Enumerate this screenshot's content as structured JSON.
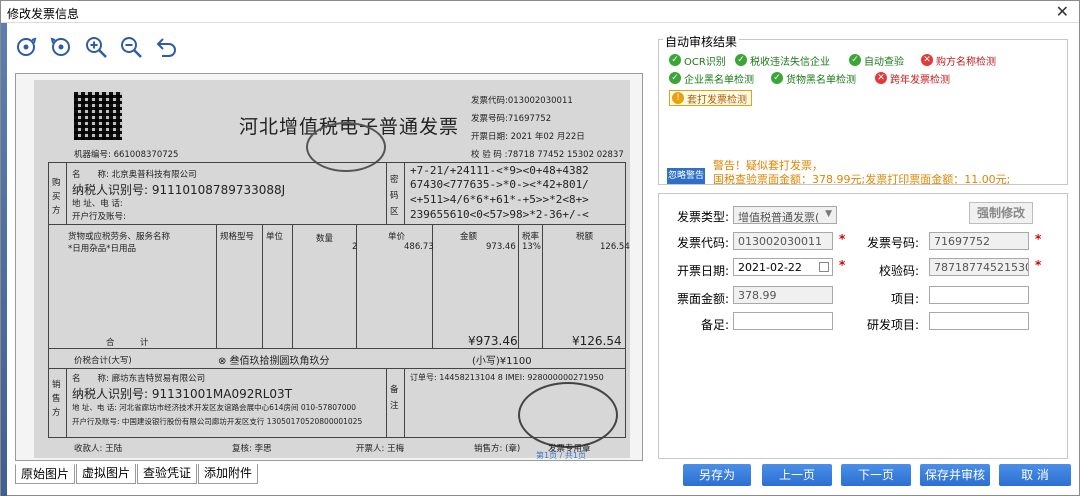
{
  "window": {
    "title": "修改发票信息",
    "close_glyph": "✕"
  },
  "toolbar": [
    {
      "name": "rotate-right-icon"
    },
    {
      "name": "rotate-left-icon"
    },
    {
      "name": "zoom-in-icon"
    },
    {
      "name": "zoom-out-icon"
    },
    {
      "name": "undo-icon"
    }
  ],
  "invoice_image": {
    "title": "河北增值税电子普通发票",
    "machine_no": "机器编号: 661008370725",
    "code": "发票代码:013002030011",
    "number": "发票号码:71697752",
    "date": "开票日期: 2021 年02 月22日",
    "check": "校 验 码 :78718 77452 15302 02837",
    "buyer_name": "名　　称: 北京奥普科技有限公司",
    "buyer_tax": "纳税人识别号: 91110108789733088J",
    "buyer_addr": "地 址、电 话:",
    "buyer_bank": "开户行及账号:",
    "cipher": [
      "+7-21/+24111-<*9><0+48+4382",
      "67430<777635->*0-><*42+801/",
      "<+511>4/6*6*+61*-+5>>*2<8+>",
      "239655610<0<57>98>*2-36+/-<"
    ],
    "item_header": [
      "货物或应税劳务、服务名称",
      "规格型号",
      "单位",
      "数量",
      "单价",
      "金额",
      "税率",
      "税额"
    ],
    "item_row": [
      "*日用杂品*日用品",
      "2",
      "486.73",
      "973.46",
      "13%",
      "126.54"
    ],
    "total_label": "合　　　计",
    "total_amount": "¥973.46",
    "total_tax": "¥126.54",
    "grand_label": "价税合计(大写)",
    "grand_words": "⊗ 叁佰玖拾捌圆玖角玖分",
    "grand_small": "(小写)¥1100",
    "seller_name": "名　　称: 廊坊东吉特贸易有限公司",
    "seller_tax": "纳税人识别号: 91131001MA092RL03T",
    "seller_addr": "地 址、电 话: 河北省廊坊市经济技术开发区友谊路会展中心614房间 010-57807000",
    "seller_bank": "开户行及账号: 中国建设银行股份有限公司廊坊开发区支行 13050170520800001025",
    "order_no": "订单号: 14458213104 8 IMEI: 928000000271950",
    "payee": "收款人: 王陆",
    "reviewer": "复核: 李思",
    "drawer": "开票人: 王梅",
    "seller_seal": "销售方: (章)",
    "stamp_text": "发票专用章",
    "side_buy": "购买方",
    "side_pwd": "密码区",
    "side_sell": "销售方",
    "side_note": "备注",
    "page_marker": "第1页 / 共1页"
  },
  "image_tabs": [
    "原始图片",
    "虚拟图片",
    "查验凭证",
    "添加附件"
  ],
  "audit": {
    "legend": "自动审核结果",
    "checks": [
      {
        "label": "OCR识别",
        "status": "ok"
      },
      {
        "label": "税收违法失信企业",
        "status": "ok"
      },
      {
        "label": "自动查验",
        "status": "ok"
      },
      {
        "label": "购方名称检测",
        "status": "bad"
      },
      {
        "label": "企业黑名单检测",
        "status": "ok"
      },
      {
        "label": "货物黑名单检测",
        "status": "ok"
      },
      {
        "label": "跨年发票检测",
        "status": "bad"
      },
      {
        "label": "套打发票检测",
        "status": "warn"
      }
    ],
    "ignore_label": "忽略警告",
    "warning_line1": "警告！疑似套打发票，",
    "warning_line2": "国税查验票面金额：378.99元;发票打印票面金额：11.00元;"
  },
  "form": {
    "type_label": "发票类型:",
    "type_value": "增值税普通发票(",
    "force_label": "强制修改",
    "code_label": "发票代码:",
    "code_value": "013002030011",
    "number_label": "发票号码:",
    "number_value": "71697752",
    "date_label": "开票日期:",
    "date_value": "2021-02-22",
    "check_label": "校验码:",
    "check_value": "78718774521530202837",
    "amount_label": "票面金额:",
    "amount_value": "378.99",
    "item_label": "项目:",
    "item_value": "",
    "note_label": "备足:",
    "note_value": "",
    "rd_label": "研发项目:",
    "rd_value": "",
    "required": "*"
  },
  "buttons": {
    "save_as": "另存为",
    "prev": "上一页",
    "next": "下一页",
    "save_review": "保存并审核",
    "cancel": "取 消"
  },
  "colors": {
    "accent": "#2c6fd1",
    "ok": "#3aa635",
    "bad": "#e23a3a",
    "warn": "#e08500"
  }
}
